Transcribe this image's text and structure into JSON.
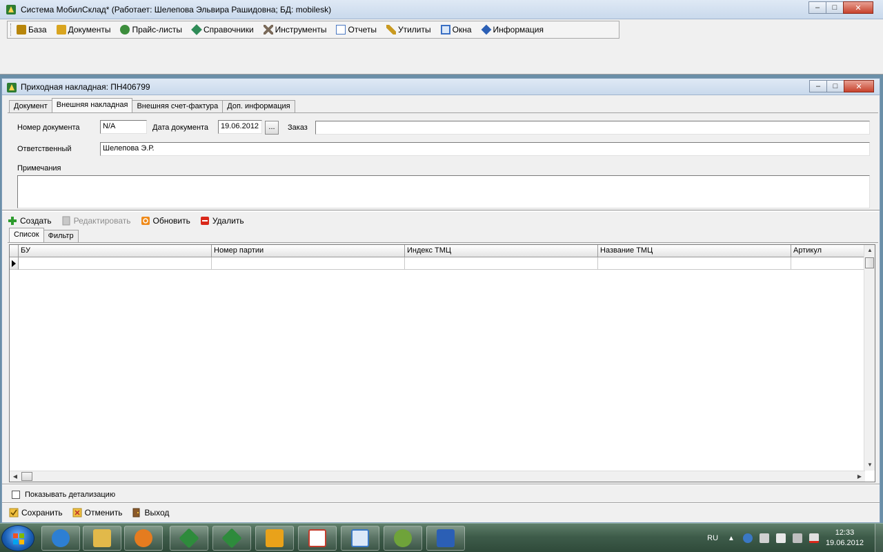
{
  "app": {
    "title": "Система МобилСклад* (Работает: Шелепова Эльвира Рашидовна; БД: mobilesk)",
    "window_buttons": {
      "minimize": "–",
      "maximize": "□",
      "close": "✕"
    }
  },
  "menu": [
    {
      "label": "База",
      "icon": "database-icon",
      "color": "#b8860b"
    },
    {
      "label": "Документы",
      "icon": "documents-icon",
      "color": "#d9a520"
    },
    {
      "label": "Прайс-листы",
      "icon": "pricelists-icon",
      "color": "#3c8d3c"
    },
    {
      "label": "Справочники",
      "icon": "reference-book-icon",
      "color": "#2e8b57"
    },
    {
      "label": "Инструменты",
      "icon": "tools-icon",
      "color": "#7a6a5a"
    },
    {
      "label": "Отчеты",
      "icon": "reports-icon",
      "color": "#4a78c2"
    },
    {
      "label": "Утилиты",
      "icon": "utilities-icon",
      "color": "#c99a20"
    },
    {
      "label": "Окна",
      "icon": "windows-icon",
      "color": "#3a6fc4"
    },
    {
      "label": "Информация",
      "icon": "info-icon",
      "color": "#2b5fb5"
    }
  ],
  "child": {
    "title": "Приходная накладная: ПН406799",
    "tabs": [
      {
        "label": "Документ",
        "active": false
      },
      {
        "label": "Внешняя накладная",
        "active": true
      },
      {
        "label": "Внешняя счет-фактура",
        "active": false
      },
      {
        "label": "Доп. информация",
        "active": false
      }
    ],
    "form": {
      "doc_number_label": "Номер документа",
      "doc_number_value": "N/A",
      "doc_date_label": "Дата документа",
      "doc_date_value": "19.06.2012",
      "dots_label": "...",
      "order_label": "Заказ",
      "order_value": "",
      "responsible_label": "Ответственный",
      "responsible_value": "Шелепова Э.Р.",
      "notes_label": "Примечания",
      "notes_value": ""
    },
    "toolbar": {
      "create": "Создать",
      "edit": "Редактировать",
      "refresh": "Обновить",
      "delete": "Удалить"
    },
    "subtabs": [
      {
        "label": "Список",
        "active": true
      },
      {
        "label": "Фильтр",
        "active": false
      }
    ],
    "grid": {
      "columns": [
        "БУ",
        "Номер партии",
        "Индекс ТМЦ",
        "Название ТМЦ",
        "Артикул"
      ],
      "rows": [
        [
          "",
          "",
          "",
          "",
          ""
        ]
      ]
    },
    "show_detail_label": "Показывать детализацию",
    "bottom": {
      "save": "Сохранить",
      "cancel": "Отменить",
      "exit": "Выход"
    }
  },
  "taskbar": {
    "apps": [
      {
        "name": "internet-explorer",
        "color": "#2d7fd3"
      },
      {
        "name": "file-explorer",
        "color": "#e2b94a"
      },
      {
        "name": "media-player",
        "color": "#e57c1f"
      },
      {
        "name": "mobilsklad-window-1",
        "color": "#2e8b3c"
      },
      {
        "name": "mobilsklad-window-2",
        "color": "#2e8b3c"
      },
      {
        "name": "outlook",
        "color": "#e9a21a"
      },
      {
        "name": "solitaire",
        "color": "#c33c2c"
      },
      {
        "name": "network-app",
        "color": "#3a78c4"
      },
      {
        "name": "mobilsklad-app",
        "color": "#6fa33a"
      },
      {
        "name": "word",
        "color": "#2b5fb5"
      }
    ],
    "language": "RU",
    "time": "12:33",
    "date": "19.06.2012"
  }
}
